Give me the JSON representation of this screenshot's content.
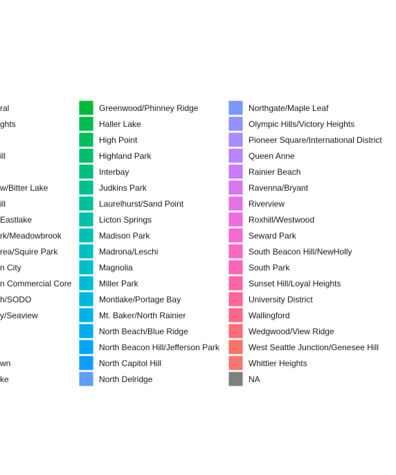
{
  "chart_data": {
    "type": "legend",
    "columns": [
      {
        "entries": [
          {
            "label": "ral",
            "color": ""
          },
          {
            "label": "ghts",
            "color": ""
          },
          {
            "label": "",
            "color": ""
          },
          {
            "label": "ill",
            "color": ""
          },
          {
            "label": "",
            "color": ""
          },
          {
            "label": "w/Bitter Lake",
            "color": ""
          },
          {
            "label": "ill",
            "color": ""
          },
          {
            "label": "Eastlake",
            "color": ""
          },
          {
            "label": "rk/Meadowbrook",
            "color": ""
          },
          {
            "label": "rea/Squire Park",
            "color": ""
          },
          {
            "label": "n City",
            "color": ""
          },
          {
            "label": "n Commercial Core",
            "color": ""
          },
          {
            "label": "h/SODO",
            "color": ""
          },
          {
            "label": "y/Seaview",
            "color": ""
          },
          {
            "label": "",
            "color": ""
          },
          {
            "label": "",
            "color": ""
          },
          {
            "label": "wn",
            "color": ""
          },
          {
            "label": "ke",
            "color": ""
          }
        ]
      },
      {
        "entries": [
          {
            "label": "Greenwood/Phinney Ridge",
            "color": "#00BA38"
          },
          {
            "label": "Haller Lake",
            "color": "#00BB4E"
          },
          {
            "label": "High Point",
            "color": "#00BC5F"
          },
          {
            "label": "Highland Park",
            "color": "#00BD6F"
          },
          {
            "label": "Interbay",
            "color": "#00BE7E"
          },
          {
            "label": "Judkins Park",
            "color": "#00BF8C"
          },
          {
            "label": "Laurelhurst/Sand Point",
            "color": "#00C09A"
          },
          {
            "label": "Licton Springs",
            "color": "#00C0A7"
          },
          {
            "label": "Madison Park",
            "color": "#00C0B3"
          },
          {
            "label": "Madrona/Leschi",
            "color": "#00BFC0"
          },
          {
            "label": "Magnolia",
            "color": "#00BDCB"
          },
          {
            "label": "Miller Park",
            "color": "#00BAD6"
          },
          {
            "label": "Montlake/Portage Bay",
            "color": "#00B7E0"
          },
          {
            "label": "Mt. Baker/North Rainier",
            "color": "#00B2E9"
          },
          {
            "label": "North Beach/Blue Ridge",
            "color": "#00ACF2"
          },
          {
            "label": "North Beacon Hill/Jefferson Park",
            "color": "#00A5F9"
          },
          {
            "label": "North Capitol Hill",
            "color": "#119DFF"
          },
          {
            "label": "North Delridge",
            "color": "#619CFF"
          }
        ]
      },
      {
        "entries": [
          {
            "label": "Northgate/Maple Leaf",
            "color": "#7997FF"
          },
          {
            "label": "Olympic Hills/Victory Heights",
            "color": "#9590FF"
          },
          {
            "label": "Pioneer Square/International District",
            "color": "#A98AFF"
          },
          {
            "label": "Queen Anne",
            "color": "#BB83FF"
          },
          {
            "label": "Rainier Beach",
            "color": "#CA7CFB"
          },
          {
            "label": "Ravenna/Bryant",
            "color": "#D876F2"
          },
          {
            "label": "Riverview",
            "color": "#E571E9"
          },
          {
            "label": "Roxhill/Westwood",
            "color": "#EF6CDE"
          },
          {
            "label": "Seward Park",
            "color": "#F768D2"
          },
          {
            "label": "South Beacon Hill/NewHolly",
            "color": "#FC66C5"
          },
          {
            "label": "South Park",
            "color": "#FF64B6"
          },
          {
            "label": "Sunset Hill/Loyal Heights",
            "color": "#FF64A7"
          },
          {
            "label": "University District",
            "color": "#FF6597"
          },
          {
            "label": "Wallingford",
            "color": "#FF6787"
          },
          {
            "label": "Wedgwood/View Ridge",
            "color": "#FD6C77"
          },
          {
            "label": "West Seattle Junction/Genesee Hill",
            "color": "#F87266"
          },
          {
            "label": "Whittier Heights",
            "color": "#F8766D"
          },
          {
            "label": "NA",
            "color": "#7F7F7F"
          }
        ]
      }
    ]
  }
}
